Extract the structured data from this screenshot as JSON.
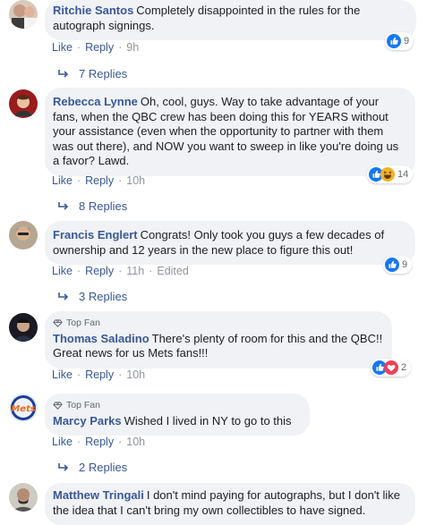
{
  "comments": [
    {
      "author": "Ritchie Santos",
      "text": "Completely disappointed in the rules for the autograph signings.",
      "actions": {
        "like": "Like",
        "reply": "Reply",
        "time": "9h",
        "edited": ""
      },
      "reactions": {
        "count": "9",
        "types": [
          "like"
        ]
      },
      "replies_label": "7 Replies"
    },
    {
      "author": "Rebecca Lynne",
      "text": "Oh, cool, guys. Way to take advantage of your fans, when the QBC crew has been doing this for YEARS without your assistance (even when the opportunity to partner with them was out there), and NOW you want to sweep in like you're doing us a favor? Lawd.",
      "actions": {
        "like": "Like",
        "reply": "Reply",
        "time": "10h",
        "edited": ""
      },
      "reactions": {
        "count": "14",
        "types": [
          "like",
          "haha"
        ]
      },
      "replies_label": "8 Replies"
    },
    {
      "author": "Francis Englert",
      "text": "Congrats! Only took you guys a few decades of ownership and 12 years in the new place to figure this out!",
      "actions": {
        "like": "Like",
        "reply": "Reply",
        "time": "11h",
        "edited": "Edited"
      },
      "reactions": {
        "count": "9",
        "types": [
          "like"
        ]
      },
      "replies_label": "3 Replies"
    },
    {
      "badge": "Top Fan",
      "author": "Thomas Saladino",
      "text": "There's plenty of room for this and the QBC!! Great news for us Mets fans!!!",
      "actions": {
        "like": "Like",
        "reply": "Reply",
        "time": "10h",
        "edited": ""
      },
      "reactions": {
        "count": "2",
        "types": [
          "like",
          "love"
        ]
      },
      "replies_label": ""
    },
    {
      "badge": "Top Fan",
      "author": "Marcy Parks",
      "text": "Wished I lived in NY to go to this",
      "actions": {
        "like": "Like",
        "reply": "Reply",
        "time": "10h",
        "edited": ""
      },
      "reactions": null,
      "replies_label": "2 Replies"
    },
    {
      "author": "Matthew Tringali",
      "text": "I don't mind paying for autographs, but I don't like the idea that I can't bring my own collectibles to have signed.",
      "actions": null,
      "reactions": null,
      "replies_label": ""
    }
  ],
  "separator": "·",
  "colors": {
    "link": "#385898",
    "bubble": "#f0f2f5",
    "like_blue": "#1877f2",
    "love_red": "#f33e58",
    "haha_yellow": "#f7b125"
  }
}
